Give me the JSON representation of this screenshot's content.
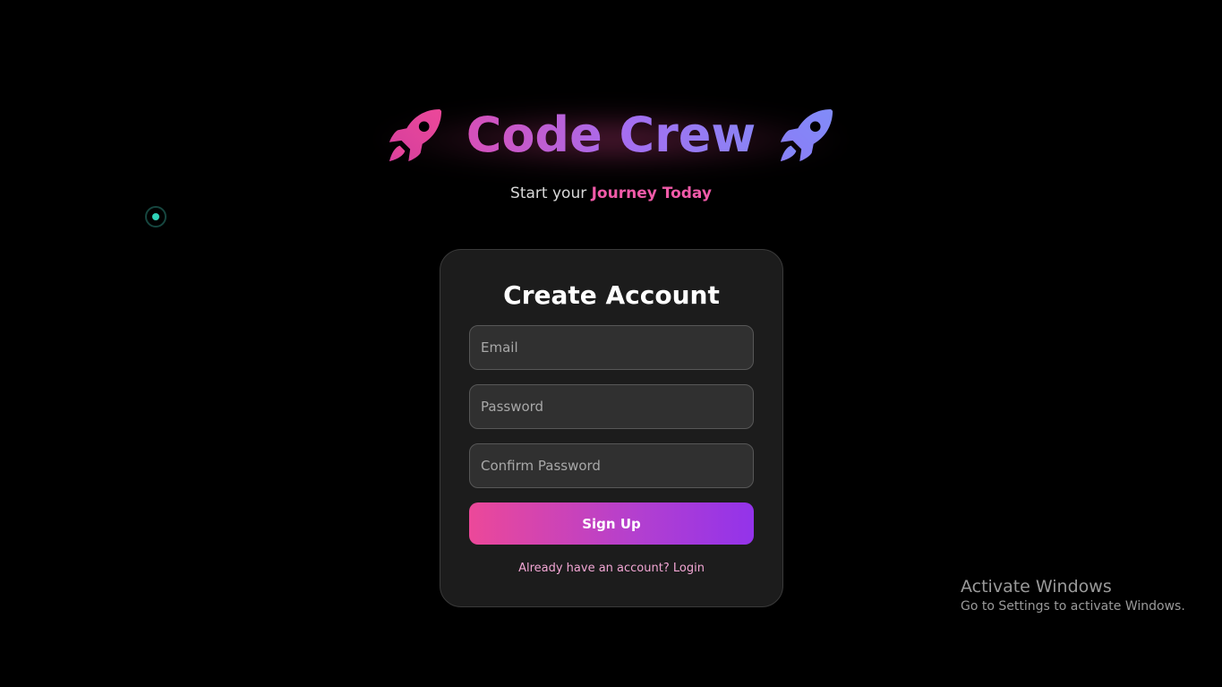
{
  "brand": {
    "title": "Code Crew",
    "rocket_icon": "rocket-icon",
    "tagline_prefix": "Start your ",
    "tagline_highlight": "Journey Today",
    "colors": {
      "pink": "#ec4899",
      "purple": "#a56ef0",
      "blue": "#818cf8"
    }
  },
  "form": {
    "title": "Create Account",
    "email_placeholder": "Email",
    "password_placeholder": "Password",
    "confirm_placeholder": "Confirm Password",
    "submit_label": "Sign Up",
    "login_link": "Already have an account? Login"
  },
  "watermark": {
    "title": "Activate Windows",
    "subtitle": "Go to Settings to activate Windows."
  }
}
